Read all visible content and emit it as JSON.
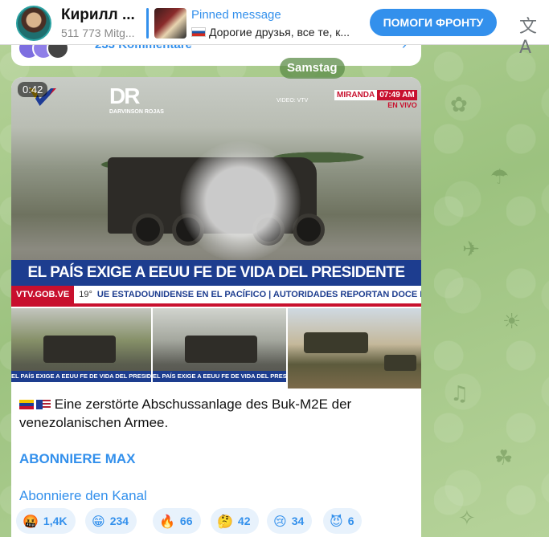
{
  "header": {
    "title": "Кирилл ...",
    "subscribers": "511 773 Mitg...",
    "pinned_label": "Pinned message",
    "pinned_text": "Дорогие друзья, все те, к...",
    "help_button": "ПОМОГИ ФРОНТУ"
  },
  "previous_message": {
    "comments": "233 Kommentare"
  },
  "date_separator": "Samstag",
  "message": {
    "video": {
      "duration": "0:42",
      "channel_logo": "DR",
      "channel_logo_sub": "DARVINSON ROJAS",
      "credit": "VIDEO: VTV",
      "live_city": "MIRANDA",
      "live_time": "07:49 AM",
      "live_label": "EN VIVO",
      "headline": "EL PAÍS EXIGE A EEUU FE DE VIDA DEL PRESIDENTE MADURO",
      "ticker_site": "VTV.GOB.VE",
      "ticker_temp": "19°",
      "ticker_news": "UE ESTADOUNIDENSE EN EL PACÍFICO  |  AUTORIDADES REPORTAN DOCE LESIO"
    },
    "thumbnails": [
      {
        "headline": "EL PAÍS EXIGE A EEUU FE DE VIDA DEL PRESIDENTE MADURO"
      },
      {
        "headline": "EL PAÍS EXIGE A EEUU FE DE VIDA DEL PRESIDENTE MADURO"
      },
      {
        "headline": ""
      }
    ],
    "caption": "Eine zerstörte Abschussanlage des Buk-M2E der venezolanischen Armee.",
    "link_bold": "ABONNIERE MAX",
    "link_plain": "Abonniere den Kanal",
    "reactions": [
      {
        "emoji": "🤬",
        "count": "1,4K"
      },
      {
        "emoji": "😁",
        "count": "234"
      },
      {
        "emoji": "🔥",
        "count": "66"
      },
      {
        "emoji": "🤔",
        "count": "42"
      },
      {
        "emoji": "😢",
        "count": "34"
      },
      {
        "emoji": "😈",
        "count": "6"
      }
    ]
  },
  "colors": {
    "accent": "#3390ec",
    "headline_bar": "#1d3d8f",
    "live_red": "#c8102e"
  },
  "icons": {
    "translate": "translate-icon",
    "chevron": "chevron-right-icon"
  }
}
